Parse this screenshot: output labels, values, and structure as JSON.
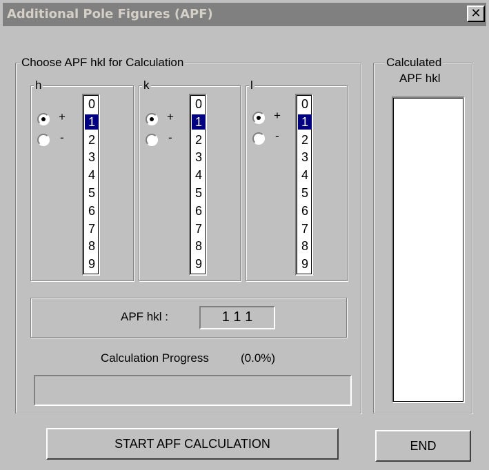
{
  "window": {
    "title": "Additional Pole Figures (APF)",
    "close_glyph": "✕"
  },
  "choose": {
    "label": "Choose APF hkl for Calculation",
    "groups": [
      {
        "label": "h",
        "plus": "+",
        "minus": "-",
        "sign": "+",
        "selected": "1"
      },
      {
        "label": "k",
        "plus": "+",
        "minus": "-",
        "sign": "+",
        "selected": "1"
      },
      {
        "label": "l",
        "plus": "+",
        "minus": "-",
        "sign": "+",
        "selected": "1"
      }
    ],
    "values": [
      "0",
      "1",
      "2",
      "3",
      "4",
      "5",
      "6",
      "7",
      "8",
      "9"
    ],
    "apf_label": "APF hkl :",
    "apf_value": "1 1 1"
  },
  "progress": {
    "label": "Calculation Progress",
    "percent_text": "(0.0%)",
    "fraction": 0.0
  },
  "calculated": {
    "label_line1": "Calculated",
    "label_line2": "APF hkl"
  },
  "buttons": {
    "start": "START APF CALCULATION",
    "end": "END"
  },
  "colors": {
    "face": "#c0c0c0",
    "selection": "#000080",
    "titlebar_inactive": "#808080"
  }
}
